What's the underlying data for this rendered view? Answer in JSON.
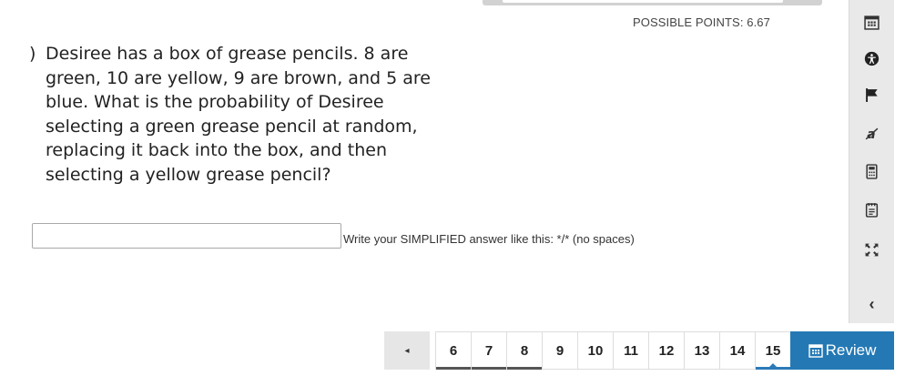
{
  "header": {
    "possible_points": "POSSIBLE POINTS: 6.67"
  },
  "question": {
    "number": ")",
    "text": "Desiree has a box of grease pencils. 8 are green, 10 are yellow, 9 are brown, and 5 are blue. What is the probability of Desiree selecting a green grease pencil at random, replacing it back into the box, and then selecting a yellow grease pencil?"
  },
  "answer": {
    "value": "",
    "placeholder": "",
    "hint": "Write your SIMPLIFIED answer like this:  */* (no spaces)"
  },
  "toolbar": {
    "icons": [
      "calendar-icon",
      "accessibility-icon",
      "flag-icon",
      "strikethrough-icon",
      "calculator-icon",
      "notepad-icon",
      "expand-icon"
    ],
    "collapse_label": "‹"
  },
  "pager": {
    "prev_label": "◂",
    "pages": [
      "6",
      "7",
      "8",
      "9",
      "10",
      "11",
      "12",
      "13",
      "14",
      "15"
    ],
    "current": "15"
  },
  "review": {
    "label": "Review"
  },
  "colors": {
    "accent": "#2479b5",
    "toolbar_bg": "#e9e9e9"
  }
}
